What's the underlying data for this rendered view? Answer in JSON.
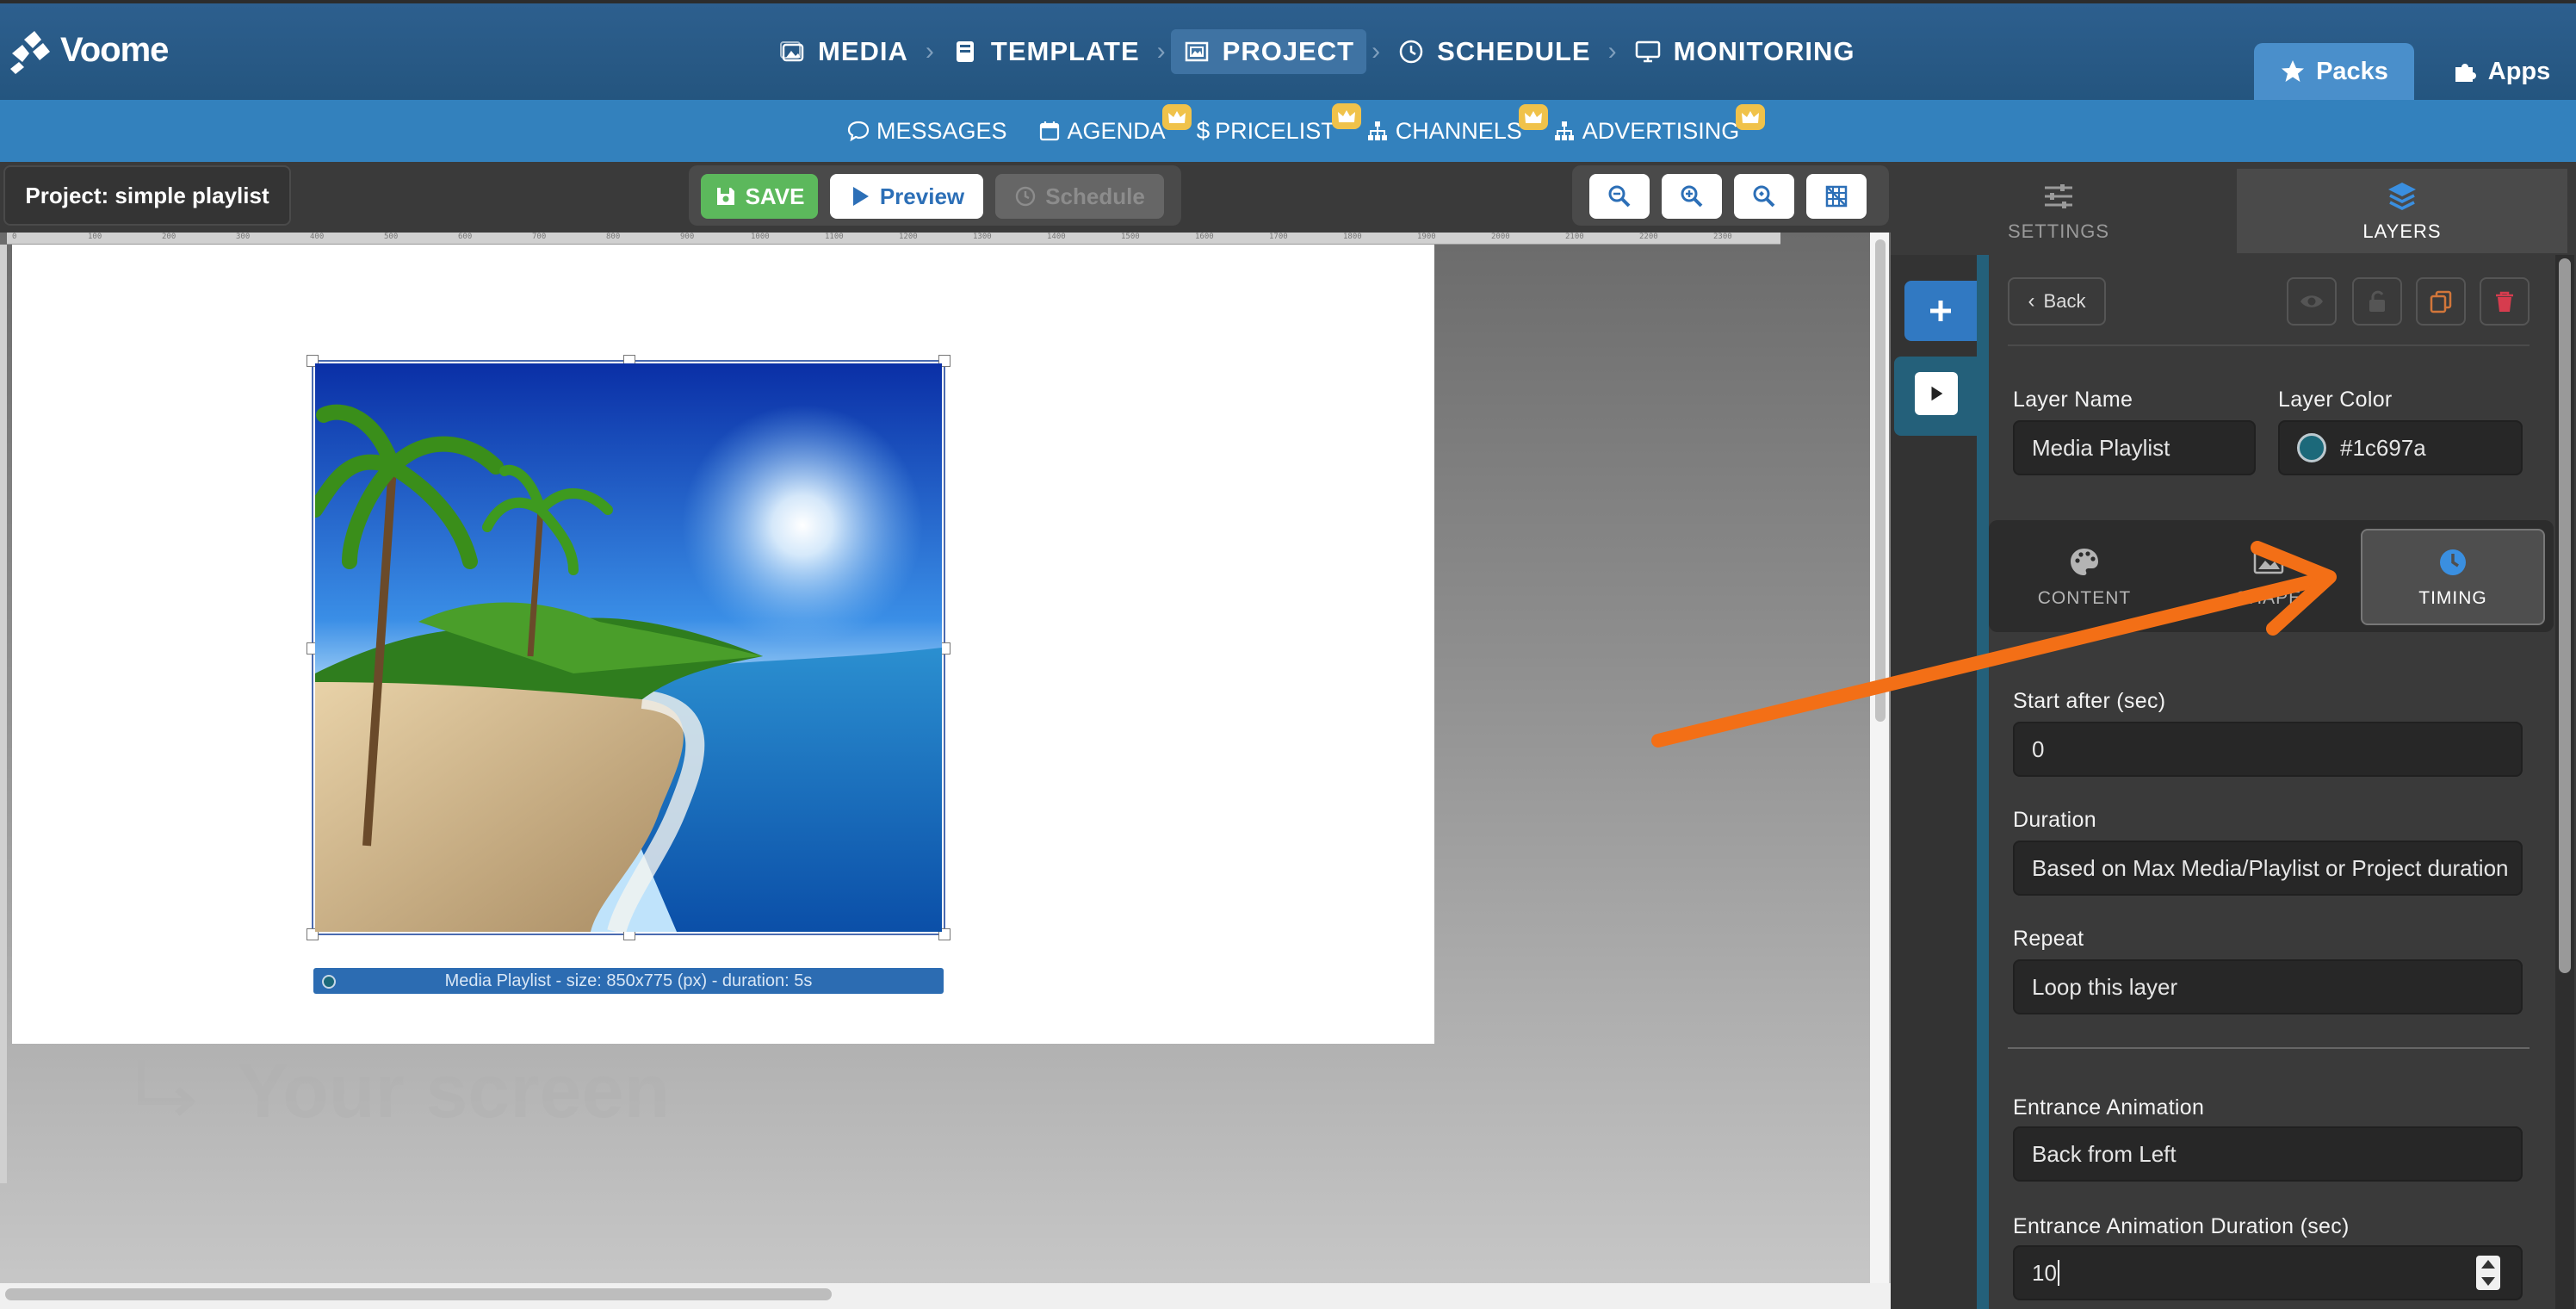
{
  "app": {
    "name": "Voome"
  },
  "mainnav": {
    "items": [
      {
        "label": "MEDIA",
        "icon": "image-icon"
      },
      {
        "label": "TEMPLATE",
        "icon": "book-icon"
      },
      {
        "label": "PROJECT",
        "icon": "frame-icon",
        "active": true
      },
      {
        "label": "SCHEDULE",
        "icon": "clock-icon"
      },
      {
        "label": "MONITORING",
        "icon": "monitor-icon"
      }
    ]
  },
  "topright": {
    "packs": "Packs",
    "apps": "Apps"
  },
  "subnav": {
    "messages": "MESSAGES",
    "agenda": "AGENDA",
    "pricelist": "PRICELIST",
    "channels": "CHANNELS",
    "advertising": "ADVERTISING"
  },
  "toolbar": {
    "project_title": "Project: simple playlist",
    "save": "SAVE",
    "preview": "Preview",
    "schedule": "Schedule"
  },
  "ruler": {
    "ticks": [
      "0",
      "100",
      "200",
      "300",
      "400",
      "500",
      "600",
      "700",
      "800",
      "900",
      "1000",
      "1100",
      "1200",
      "1300",
      "1400",
      "1500",
      "1600",
      "1700",
      "1800",
      "1900",
      "2000",
      "2100",
      "2200",
      "2300"
    ]
  },
  "canvas": {
    "layer_caption": "Media Playlist - size: 850x775 (px) - duration: 5s",
    "your_screen": "Your screen"
  },
  "panel": {
    "tab_settings": "SETTINGS",
    "tab_layers": "LAYERS",
    "back": "Back",
    "layer_name_label": "Layer Name",
    "layer_name_value": "Media Playlist",
    "layer_color_label": "Layer Color",
    "layer_color_value": "#1c697a",
    "subtab_content": "CONTENT",
    "subtab_shape": "SHAPE",
    "subtab_timing": "TIMING",
    "start_after_label": "Start after (sec)",
    "start_after_value": "0",
    "duration_label": "Duration",
    "duration_value": "Based on Max Media/Playlist or Project duration",
    "repeat_label": "Repeat",
    "repeat_value": "Loop this layer",
    "entrance_anim_label": "Entrance Animation",
    "entrance_anim_value": "Back from Left",
    "entrance_dur_label": "Entrance Animation Duration (sec)",
    "entrance_dur_value": "10"
  },
  "colors": {
    "accent": "#3381bd",
    "layer_color": "#1c697a",
    "save_green": "#5cb85c",
    "annotation_arrow": "#f36f16"
  }
}
